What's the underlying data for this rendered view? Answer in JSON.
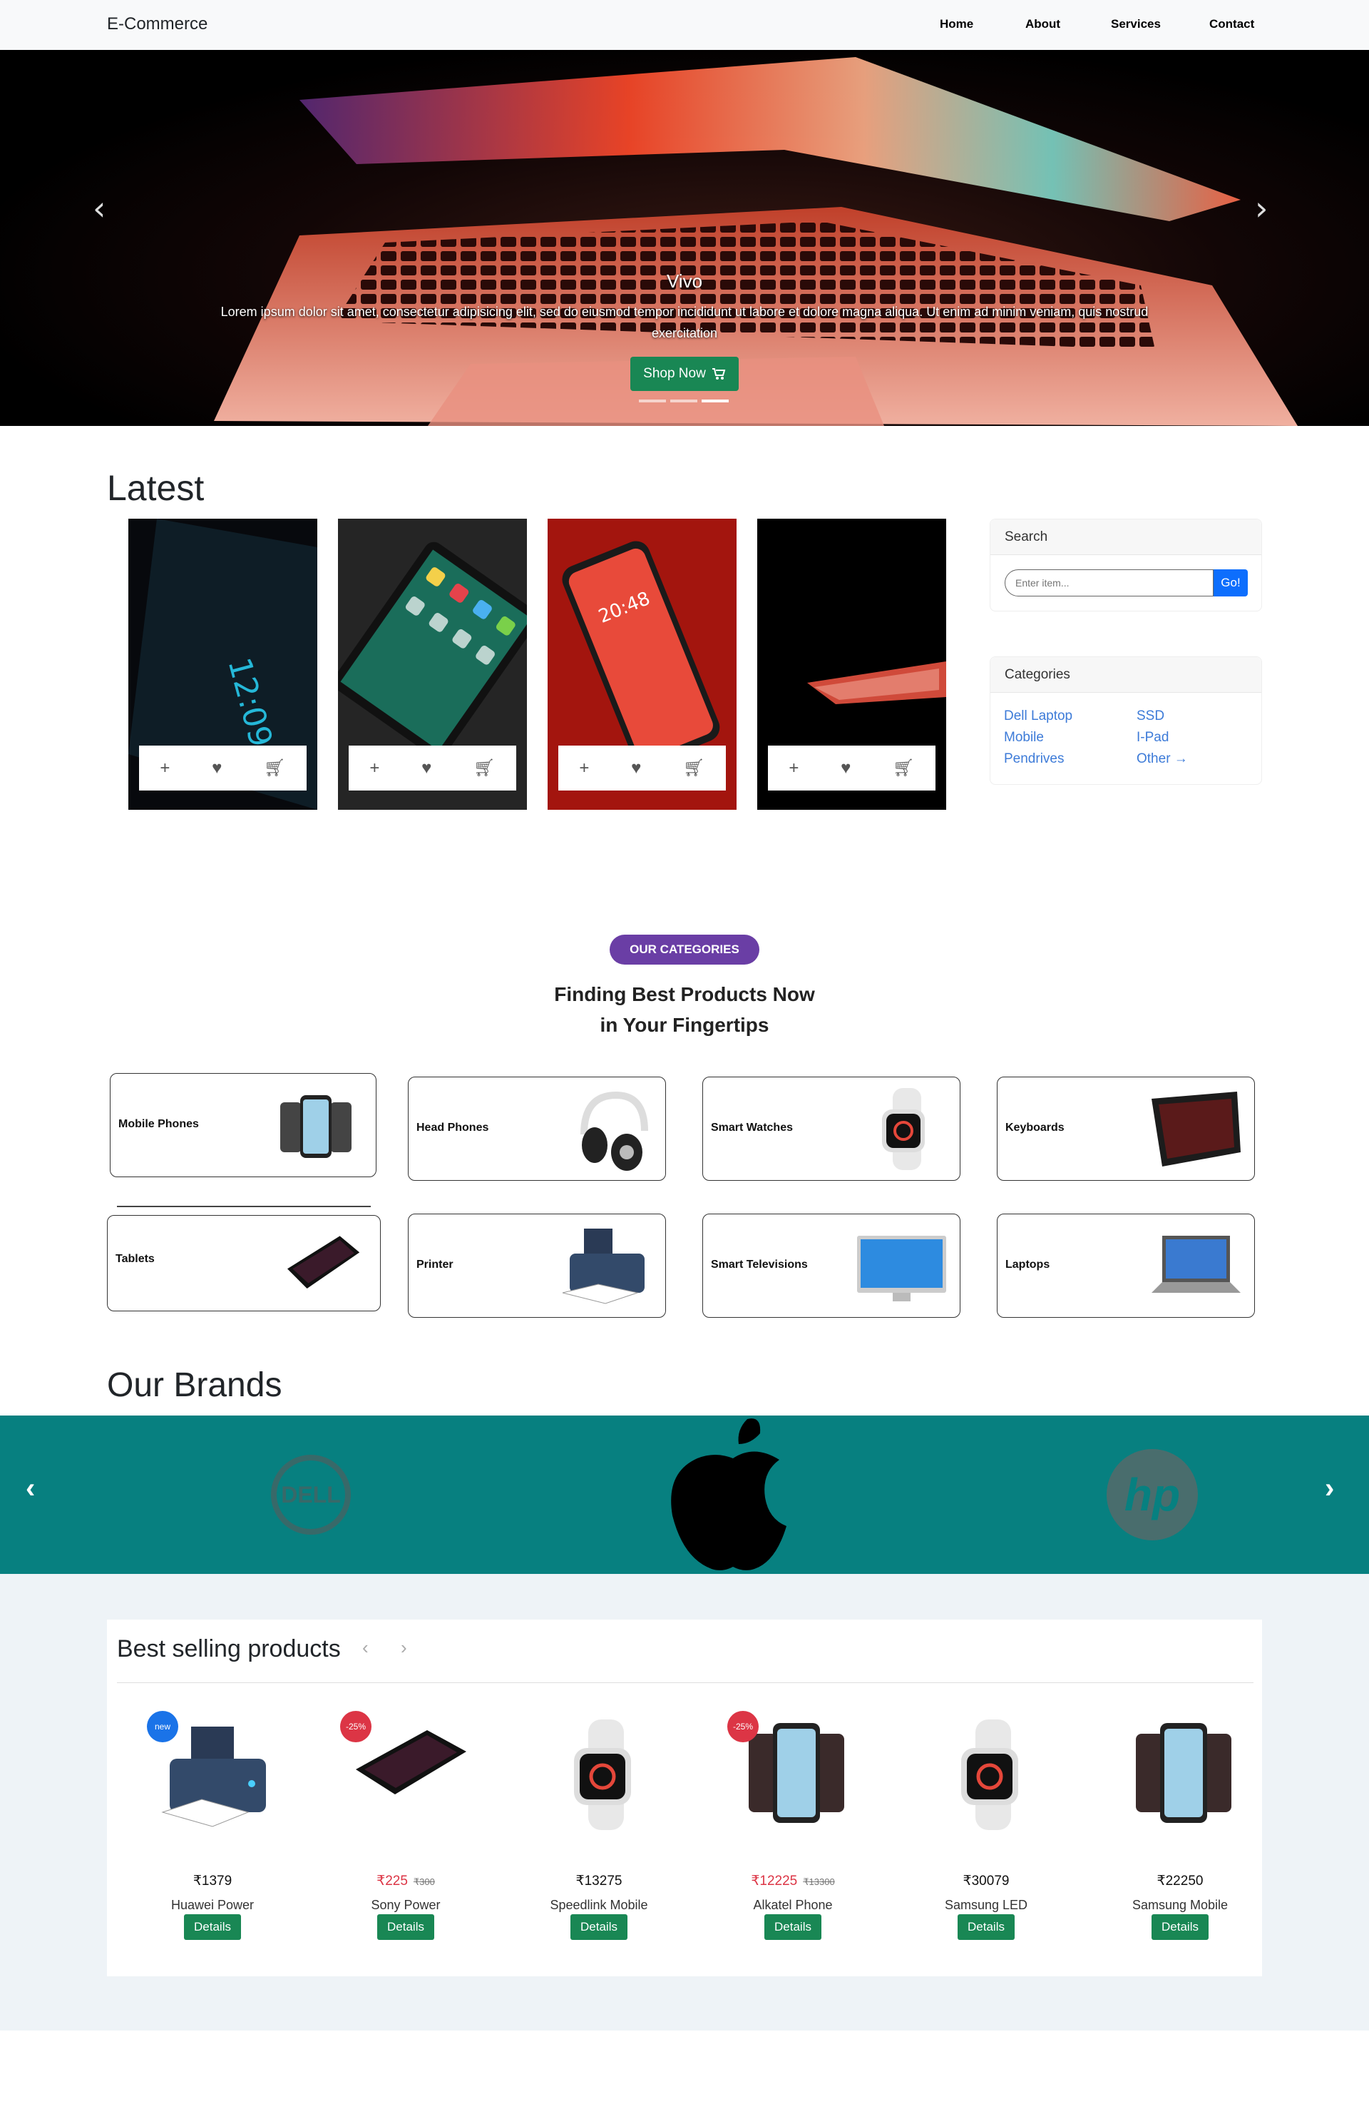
{
  "navbar": {
    "brand": "E-Commerce",
    "links": [
      "Home",
      "About",
      "Services",
      "Contact"
    ]
  },
  "hero": {
    "title": "Vivo",
    "text": "Lorem ipsum dolor sit amet, consectetur adipisicing elit, sed do eiusmod tempor incididunt ut labore et dolore magna aliqua. Ut enim ad minim veniam, quis nostrud exercitation",
    "button_label": "Shop Now",
    "button_icon": "cart-icon"
  },
  "latest": {
    "title": "Latest",
    "products": [
      {
        "image": "phone-clock-image"
      },
      {
        "image": "tablet-apps-image"
      },
      {
        "image": "red-phone-image"
      },
      {
        "image": "laptop-glow-image"
      }
    ],
    "action_icons": [
      "plus-icon",
      "heart-icon",
      "cart-icon"
    ]
  },
  "sidebar": {
    "search_title": "Search",
    "search_placeholder": "Enter item...",
    "search_button": "Go!",
    "categories_title": "Categories",
    "categories": [
      "Dell Laptop",
      "Mobile",
      "Pendrives",
      "SSD",
      "I-Pad",
      "Other →"
    ]
  },
  "categories": {
    "pill": "OUR CATEGORIES",
    "heading_line1": "Finding Best Products Now",
    "heading_line2": "in Your Fingertips",
    "items": [
      "Mobile Phones",
      "Head Phones",
      "Smart Watches",
      "Keyboards",
      "Tablets",
      "Printer",
      "Smart Televisions",
      "Laptops"
    ]
  },
  "brands": {
    "title": "Our Brands",
    "logos": [
      "dell-logo",
      "apple-logo",
      "hp-logo"
    ],
    "dell_text": "DELL",
    "hp_text": "hp"
  },
  "best_selling": {
    "title": "Best selling products",
    "currency": "₹",
    "button_label": "Details",
    "items": [
      {
        "name": "Huawei Power",
        "price": "₹1379",
        "old_price": "",
        "badge": "new",
        "badge_color": "#1a73e8",
        "image": "printer"
      },
      {
        "name": "Sony Power",
        "price": "₹225",
        "old_price": "₹300",
        "badge": "-25%",
        "badge_color": "#dc3545",
        "image": "tablet"
      },
      {
        "name": "Speedlink Mobile",
        "price": "₹13275",
        "old_price": "",
        "badge": "",
        "badge_color": "",
        "image": "watch"
      },
      {
        "name": "Alkatel Phone",
        "price": "₹12225",
        "old_price": "₹13300",
        "badge": "-25%",
        "badge_color": "#dc3545",
        "image": "phones"
      },
      {
        "name": "Samsung LED",
        "price": "₹30079",
        "old_price": "",
        "badge": "",
        "badge_color": "",
        "image": "watch"
      },
      {
        "name": "Samsung Mobile",
        "price": "₹22250",
        "old_price": "",
        "badge": "",
        "badge_color": "",
        "image": "phones"
      }
    ]
  },
  "colors": {
    "accent_green": "#198754",
    "link_blue": "#3d7bd8",
    "brand_band": "#078080",
    "pill_purple": "#6a3ea5"
  }
}
